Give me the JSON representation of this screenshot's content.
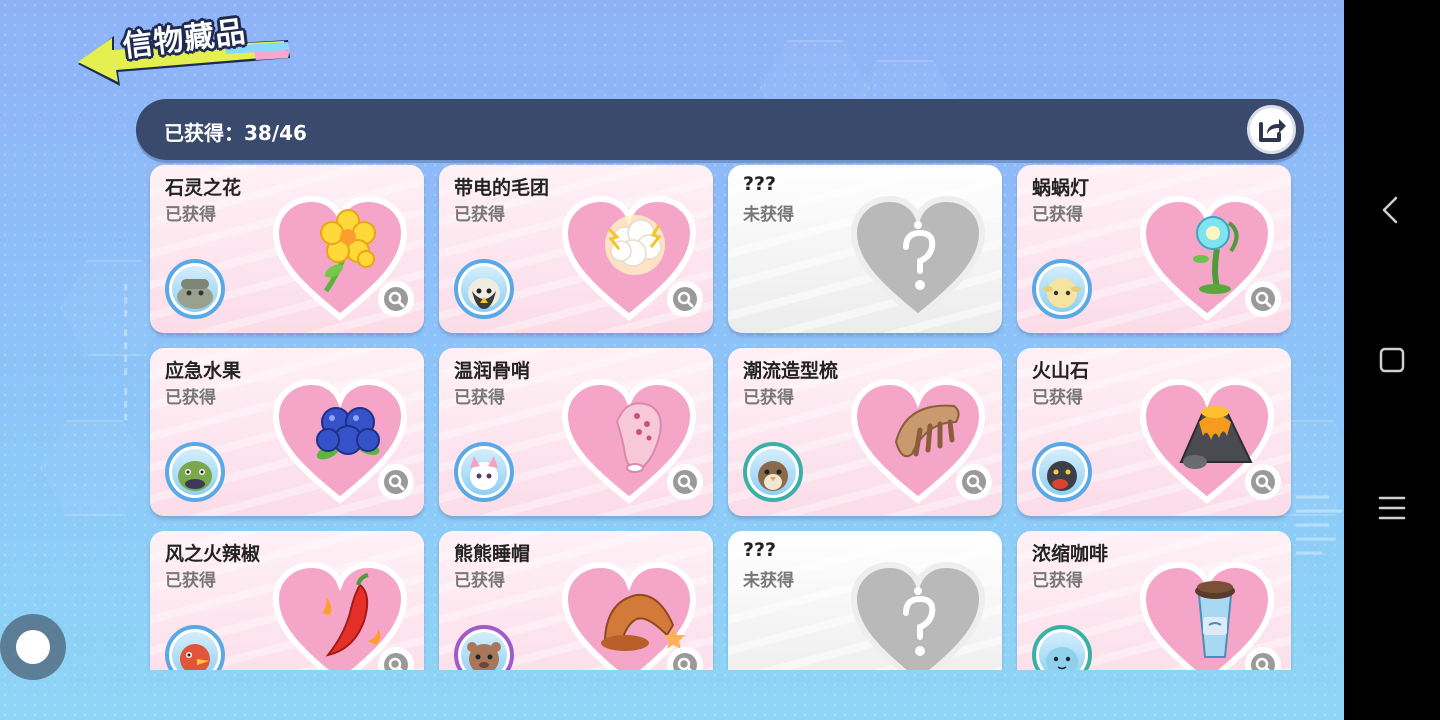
{
  "header": {
    "title": "信物藏品"
  },
  "stats": {
    "obtained_label": "已获得：38/46"
  },
  "colors": {
    "got_heart": "#f6a8c9",
    "locked_heart": "#b9b9b9",
    "stats_bar": "#3a4a6c",
    "back_arrow": "#e0f04a"
  },
  "items": [
    {
      "name": "石灵之花",
      "status": "已获得",
      "obtained": true,
      "icon": "yellow-flower-icon",
      "avatar": "stone-creature-avatar"
    },
    {
      "name": "带电的毛团",
      "status": "已获得",
      "obtained": true,
      "icon": "electric-fluff-icon",
      "avatar": "white-fur-avatar"
    },
    {
      "name": "???",
      "status": "未获得",
      "obtained": false,
      "icon": "question-heart-icon",
      "avatar": ""
    },
    {
      "name": "蜗蜗灯",
      "status": "已获得",
      "obtained": true,
      "icon": "snail-lamp-icon",
      "avatar": "yellow-sheep-avatar"
    },
    {
      "name": "应急水果",
      "status": "已获得",
      "obtained": true,
      "icon": "blueberry-icon",
      "avatar": "green-turtle-avatar"
    },
    {
      "name": "温润骨哨",
      "status": "已获得",
      "obtained": true,
      "icon": "bone-whistle-icon",
      "avatar": "pink-cat-avatar"
    },
    {
      "name": "潮流造型梳",
      "status": "已获得",
      "obtained": true,
      "icon": "comb-icon",
      "avatar": "brown-bird-avatar"
    },
    {
      "name": "火山石",
      "status": "已获得",
      "obtained": true,
      "icon": "volcano-rock-icon",
      "avatar": "dark-dragon-avatar"
    },
    {
      "name": "风之火辣椒",
      "status": "已获得",
      "obtained": true,
      "icon": "chili-pepper-icon",
      "avatar": "red-bird-avatar"
    },
    {
      "name": "熊熊睡帽",
      "status": "已获得",
      "obtained": true,
      "icon": "sleep-cap-icon",
      "avatar": "brown-bear-avatar"
    },
    {
      "name": "???",
      "status": "未获得",
      "obtained": false,
      "icon": "question-heart-icon",
      "avatar": ""
    },
    {
      "name": "浓缩咖啡",
      "status": "已获得",
      "obtained": true,
      "icon": "coffee-cup-icon",
      "avatar": "blue-slime-avatar"
    }
  ]
}
